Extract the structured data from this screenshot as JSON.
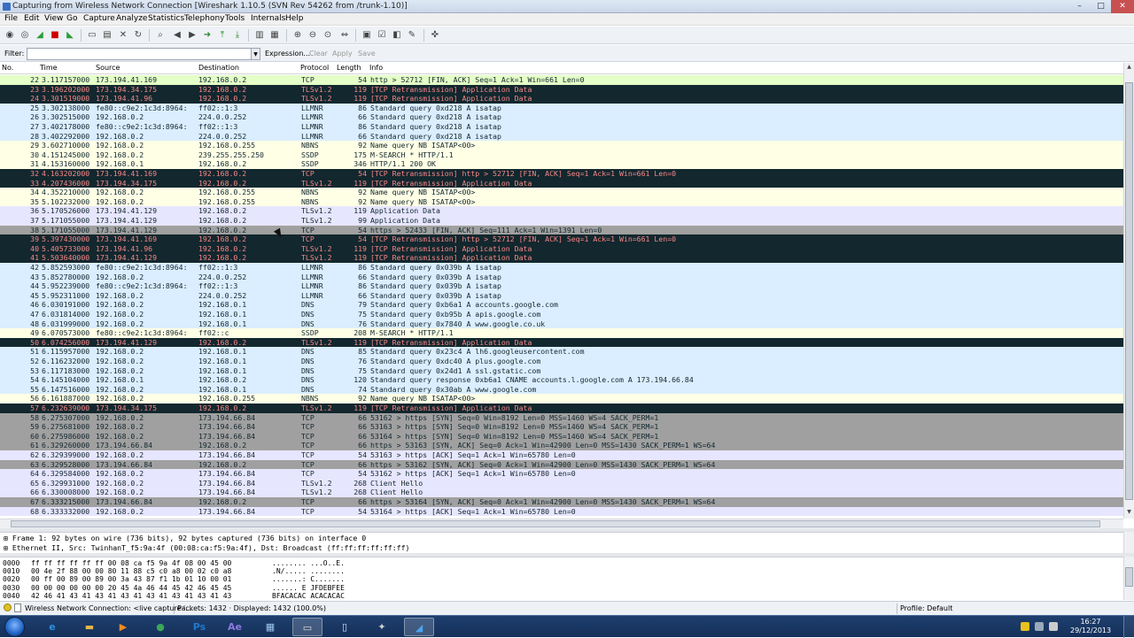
{
  "window": {
    "title": "Capturing from Wireless Network Connection   [Wireshark 1.10.5  (SVN Rev 54262 from /trunk-1.10)]",
    "min_icon": "minimize-icon",
    "max_icon": "maximize-icon",
    "close_icon": "close-icon",
    "min_glyph": "–",
    "max_glyph": "□",
    "close_glyph": "✕"
  },
  "menu": [
    "File",
    "Edit",
    "View",
    "Go",
    "Capture",
    "Analyze",
    "Statistics",
    "Telephony",
    "Tools",
    "Internals",
    "Help"
  ],
  "toolbar": {
    "icons": [
      {
        "name": "interfaces-icon",
        "glyph": "◉"
      },
      {
        "name": "options-icon",
        "glyph": "◎"
      },
      {
        "name": "start-capture-icon",
        "glyph": "◢"
      },
      {
        "name": "stop-capture-icon",
        "glyph": "■"
      },
      {
        "name": "restart-capture-icon",
        "glyph": "◣"
      },
      {
        "name": "open-file-icon",
        "glyph": "▭"
      },
      {
        "name": "save-file-icon",
        "glyph": "▤"
      },
      {
        "name": "close-file-icon",
        "glyph": "✕"
      },
      {
        "name": "reload-icon",
        "glyph": "↻"
      },
      {
        "name": "find-packet-icon",
        "glyph": "⌕"
      },
      {
        "name": "go-back-icon",
        "glyph": "◀"
      },
      {
        "name": "go-forward-icon",
        "glyph": "▶"
      },
      {
        "name": "go-to-packet-icon",
        "glyph": "➜"
      },
      {
        "name": "first-packet-icon",
        "glyph": "⤒"
      },
      {
        "name": "last-packet-icon",
        "glyph": "⤓"
      },
      {
        "name": "colorize-icon",
        "glyph": "▥"
      },
      {
        "name": "autoscroll-icon",
        "glyph": "▦"
      },
      {
        "name": "zoom-in-icon",
        "glyph": "⊕"
      },
      {
        "name": "zoom-out-icon",
        "glyph": "⊖"
      },
      {
        "name": "normal-size-icon",
        "glyph": "⊙"
      },
      {
        "name": "resize-columns-icon",
        "glyph": "⇔"
      },
      {
        "name": "capture-filters-icon",
        "glyph": "▣"
      },
      {
        "name": "display-filters-icon",
        "glyph": "☑"
      },
      {
        "name": "coloring-rules-icon",
        "glyph": "◧"
      },
      {
        "name": "preferences-icon",
        "glyph": "✎"
      },
      {
        "name": "help-icon",
        "glyph": "✜"
      }
    ]
  },
  "filter": {
    "label": "Filter:",
    "value": "",
    "dropdown_icon": "dropdown-arrow-icon",
    "dropdown_glyph": "▼",
    "expression": "Expression...",
    "clear": "Clear",
    "apply": "Apply",
    "save": "Save"
  },
  "columns": {
    "no": "No.",
    "time": "Time",
    "source": "Source",
    "destination": "Destination",
    "protocol": "Protocol",
    "length": "Length",
    "info": "Info"
  },
  "packets": [
    {
      "no": "22",
      "time": "3.117157000",
      "src": "173.194.41.169",
      "dst": "192.168.0.2",
      "proto": "TCP",
      "len": "54",
      "info": "http > 52712 [FIN, ACK] Seq=1 Ack=1 Win=661 Len=0",
      "kind": "http"
    },
    {
      "no": "23",
      "time": "3.196202000",
      "src": "173.194.34.175",
      "dst": "192.168.0.2",
      "proto": "TLSv1.2",
      "len": "119",
      "info": "[TCP Retransmission] Application Data",
      "kind": "tlsr"
    },
    {
      "no": "24",
      "time": "3.301519000",
      "src": "173.194.41.96",
      "dst": "192.168.0.2",
      "proto": "TLSv1.2",
      "len": "119",
      "info": "[TCP Retransmission] Application Data",
      "kind": "tlsr"
    },
    {
      "no": "25",
      "time": "3.302138000",
      "src": "fe80::c9e2:1c3d:8964:",
      "dst": "ff02::1:3",
      "proto": "LLMNR",
      "len": "86",
      "info": "Standard query 0xd218  A isatap",
      "kind": "llmnr"
    },
    {
      "no": "26",
      "time": "3.302515000",
      "src": "192.168.0.2",
      "dst": "224.0.0.252",
      "proto": "LLMNR",
      "len": "66",
      "info": "Standard query 0xd218  A isatap",
      "kind": "llmnr"
    },
    {
      "no": "27",
      "time": "3.402178000",
      "src": "fe80::c9e2:1c3d:8964:",
      "dst": "ff02::1:3",
      "proto": "LLMNR",
      "len": "86",
      "info": "Standard query 0xd218  A isatap",
      "kind": "llmnr"
    },
    {
      "no": "28",
      "time": "3.402292000",
      "src": "192.168.0.2",
      "dst": "224.0.0.252",
      "proto": "LLMNR",
      "len": "66",
      "info": "Standard query 0xd218  A isatap",
      "kind": "llmnr"
    },
    {
      "no": "29",
      "time": "3.602710000",
      "src": "192.168.0.2",
      "dst": "192.168.0.255",
      "proto": "NBNS",
      "len": "92",
      "info": "Name query NB ISATAP<00>",
      "kind": "nbns"
    },
    {
      "no": "30",
      "time": "4.151245000",
      "src": "192.168.0.2",
      "dst": "239.255.255.250",
      "proto": "SSDP",
      "len": "175",
      "info": "M-SEARCH * HTTP/1.1",
      "kind": "ssdp"
    },
    {
      "no": "31",
      "time": "4.153160000",
      "src": "192.168.0.1",
      "dst": "192.168.0.2",
      "proto": "SSDP",
      "len": "346",
      "info": "HTTP/1.1 200 OK",
      "kind": "ssdp"
    },
    {
      "no": "32",
      "time": "4.163202000",
      "src": "173.194.41.169",
      "dst": "192.168.0.2",
      "proto": "TCP",
      "len": "54",
      "info": "[TCP Retransmission] http > 52712 [FIN, ACK] Seq=1 Ack=1 Win=661 Len=0",
      "kind": "tlsr"
    },
    {
      "no": "33",
      "time": "4.207436000",
      "src": "173.194.34.175",
      "dst": "192.168.0.2",
      "proto": "TLSv1.2",
      "len": "119",
      "info": "[TCP Retransmission] Application Data",
      "kind": "tlsr"
    },
    {
      "no": "34",
      "time": "4.352210000",
      "src": "192.168.0.2",
      "dst": "192.168.0.255",
      "proto": "NBNS",
      "len": "92",
      "info": "Name query NB ISATAP<00>",
      "kind": "nbns"
    },
    {
      "no": "35",
      "time": "5.102232000",
      "src": "192.168.0.2",
      "dst": "192.168.0.255",
      "proto": "NBNS",
      "len": "92",
      "info": "Name query NB ISATAP<00>",
      "kind": "nbns"
    },
    {
      "no": "36",
      "time": "5.170526000",
      "src": "173.194.41.129",
      "dst": "192.168.0.2",
      "proto": "TLSv1.2",
      "len": "119",
      "info": "Application Data",
      "kind": "tls"
    },
    {
      "no": "37",
      "time": "5.171055000",
      "src": "173.194.41.129",
      "dst": "192.168.0.2",
      "proto": "TLSv1.2",
      "len": "99",
      "info": "Application Data",
      "kind": "tls"
    },
    {
      "no": "38",
      "time": "5.171055000",
      "src": "173.194.41.129",
      "dst": "192.168.0.2",
      "proto": "TCP",
      "len": "54",
      "info": "https > 52433 [FIN, ACK] Seq=111 Ack=1 Win=1391 Len=0",
      "kind": "fin"
    },
    {
      "no": "39",
      "time": "5.397430000",
      "src": "173.194.41.169",
      "dst": "192.168.0.2",
      "proto": "TCP",
      "len": "54",
      "info": "[TCP Retransmission] http > 52712 [FIN, ACK] Seq=1 Ack=1 Win=661 Len=0",
      "kind": "tlsr"
    },
    {
      "no": "40",
      "time": "5.405733000",
      "src": "173.194.41.96",
      "dst": "192.168.0.2",
      "proto": "TLSv1.2",
      "len": "119",
      "info": "[TCP Retransmission] Application Data",
      "kind": "tlsr"
    },
    {
      "no": "41",
      "time": "5.503640000",
      "src": "173.194.41.129",
      "dst": "192.168.0.2",
      "proto": "TLSv1.2",
      "len": "119",
      "info": "[TCP Retransmission] Application Data",
      "kind": "tlsr"
    },
    {
      "no": "42",
      "time": "5.852593000",
      "src": "fe80::c9e2:1c3d:8964:",
      "dst": "ff02::1:3",
      "proto": "LLMNR",
      "len": "86",
      "info": "Standard query 0x039b  A isatap",
      "kind": "llmnr"
    },
    {
      "no": "43",
      "time": "5.852780000",
      "src": "192.168.0.2",
      "dst": "224.0.0.252",
      "proto": "LLMNR",
      "len": "66",
      "info": "Standard query 0x039b  A isatap",
      "kind": "llmnr"
    },
    {
      "no": "44",
      "time": "5.952239000",
      "src": "fe80::c9e2:1c3d:8964:",
      "dst": "ff02::1:3",
      "proto": "LLMNR",
      "len": "86",
      "info": "Standard query 0x039b  A isatap",
      "kind": "llmnr"
    },
    {
      "no": "45",
      "time": "5.952311000",
      "src": "192.168.0.2",
      "dst": "224.0.0.252",
      "proto": "LLMNR",
      "len": "66",
      "info": "Standard query 0x039b  A isatap",
      "kind": "llmnr"
    },
    {
      "no": "46",
      "time": "6.030191000",
      "src": "192.168.0.2",
      "dst": "192.168.0.1",
      "proto": "DNS",
      "len": "79",
      "info": "Standard query 0xb6a1  A accounts.google.com",
      "kind": "dns"
    },
    {
      "no": "47",
      "time": "6.031814000",
      "src": "192.168.0.2",
      "dst": "192.168.0.1",
      "proto": "DNS",
      "len": "75",
      "info": "Standard query 0xb95b  A apis.google.com",
      "kind": "dns"
    },
    {
      "no": "48",
      "time": "6.031999000",
      "src": "192.168.0.2",
      "dst": "192.168.0.1",
      "proto": "DNS",
      "len": "76",
      "info": "Standard query 0x7840  A www.google.co.uk",
      "kind": "dns"
    },
    {
      "no": "49",
      "time": "6.070573000",
      "src": "fe80::c9e2:1c3d:8964:",
      "dst": "ff02::c",
      "proto": "SSDP",
      "len": "208",
      "info": "M-SEARCH * HTTP/1.1",
      "kind": "ssdp"
    },
    {
      "no": "50",
      "time": "6.074256000",
      "src": "173.194.41.129",
      "dst": "192.168.0.2",
      "proto": "TLSv1.2",
      "len": "119",
      "info": "[TCP Retransmission] Application Data",
      "kind": "tlsr"
    },
    {
      "no": "51",
      "time": "6.115957000",
      "src": "192.168.0.2",
      "dst": "192.168.0.1",
      "proto": "DNS",
      "len": "85",
      "info": "Standard query 0x23c4  A lh6.googleusercontent.com",
      "kind": "dns"
    },
    {
      "no": "52",
      "time": "6.116232000",
      "src": "192.168.0.2",
      "dst": "192.168.0.1",
      "proto": "DNS",
      "len": "76",
      "info": "Standard query 0xdc40  A plus.google.com",
      "kind": "dns"
    },
    {
      "no": "53",
      "time": "6.117183000",
      "src": "192.168.0.2",
      "dst": "192.168.0.1",
      "proto": "DNS",
      "len": "75",
      "info": "Standard query 0x24d1  A ssl.gstatic.com",
      "kind": "dns"
    },
    {
      "no": "54",
      "time": "6.145104000",
      "src": "192.168.0.1",
      "dst": "192.168.0.2",
      "proto": "DNS",
      "len": "120",
      "info": "Standard query response 0xb6a1  CNAME accounts.l.google.com A 173.194.66.84",
      "kind": "dns"
    },
    {
      "no": "55",
      "time": "6.147516000",
      "src": "192.168.0.2",
      "dst": "192.168.0.1",
      "proto": "DNS",
      "len": "74",
      "info": "Standard query 0x30ab  A www.google.com",
      "kind": "dns"
    },
    {
      "no": "56",
      "time": "6.161887000",
      "src": "192.168.0.2",
      "dst": "192.168.0.255",
      "proto": "NBNS",
      "len": "92",
      "info": "Name query NB ISATAP<00>",
      "kind": "nbns"
    },
    {
      "no": "57",
      "time": "6.232639000",
      "src": "173.194.34.175",
      "dst": "192.168.0.2",
      "proto": "TLSv1.2",
      "len": "119",
      "info": "[TCP Retransmission] Application Data",
      "kind": "tlsr"
    },
    {
      "no": "58",
      "time": "6.275307000",
      "src": "192.168.0.2",
      "dst": "173.194.66.84",
      "proto": "TCP",
      "len": "66",
      "info": "53162 > https [SYN] Seq=0 Win=8192 Len=0 MSS=1460 WS=4 SACK_PERM=1",
      "kind": "syn"
    },
    {
      "no": "59",
      "time": "6.275681000",
      "src": "192.168.0.2",
      "dst": "173.194.66.84",
      "proto": "TCP",
      "len": "66",
      "info": "53163 > https [SYN] Seq=0 Win=8192 Len=0 MSS=1460 WS=4 SACK_PERM=1",
      "kind": "syn"
    },
    {
      "no": "60",
      "time": "6.275986000",
      "src": "192.168.0.2",
      "dst": "173.194.66.84",
      "proto": "TCP",
      "len": "66",
      "info": "53164 > https [SYN] Seq=0 Win=8192 Len=0 MSS=1460 WS=4 SACK_PERM=1",
      "kind": "syn"
    },
    {
      "no": "61",
      "time": "6.329260000",
      "src": "173.194.66.84",
      "dst": "192.168.0.2",
      "proto": "TCP",
      "len": "66",
      "info": "https > 53163 [SYN, ACK] Seq=0 Ack=1 Win=42900 Len=0 MSS=1430 SACK_PERM=1 WS=64",
      "kind": "syn"
    },
    {
      "no": "62",
      "time": "6.329399000",
      "src": "192.168.0.2",
      "dst": "173.194.66.84",
      "proto": "TCP",
      "len": "54",
      "info": "53163 > https [ACK] Seq=1 Ack=1 Win=65780 Len=0",
      "kind": "tcp"
    },
    {
      "no": "63",
      "time": "6.329528000",
      "src": "173.194.66.84",
      "dst": "192.168.0.2",
      "proto": "TCP",
      "len": "66",
      "info": "https > 53162 [SYN, ACK] Seq=0 Ack=1 Win=42900 Len=0 MSS=1430 SACK_PERM=1 WS=64",
      "kind": "syn"
    },
    {
      "no": "64",
      "time": "6.329584000",
      "src": "192.168.0.2",
      "dst": "173.194.66.84",
      "proto": "TCP",
      "len": "54",
      "info": "53162 > https [ACK] Seq=1 Ack=1 Win=65780 Len=0",
      "kind": "tcp"
    },
    {
      "no": "65",
      "time": "6.329931000",
      "src": "192.168.0.2",
      "dst": "173.194.66.84",
      "proto": "TLSv1.2",
      "len": "268",
      "info": "Client Hello",
      "kind": "tcp"
    },
    {
      "no": "66",
      "time": "6.330008000",
      "src": "192.168.0.2",
      "dst": "173.194.66.84",
      "proto": "TLSv1.2",
      "len": "268",
      "info": "Client Hello",
      "kind": "tcp"
    },
    {
      "no": "67",
      "time": "6.333215000",
      "src": "173.194.66.84",
      "dst": "192.168.0.2",
      "proto": "TCP",
      "len": "66",
      "info": "https > 53164 [SYN, ACK] Seq=0 Ack=1 Win=42900 Len=0 MSS=1430 SACK_PERM=1 WS=64",
      "kind": "syn"
    },
    {
      "no": "68",
      "time": "6.333332000",
      "src": "192.168.0.2",
      "dst": "173.194.66.84",
      "proto": "TCP",
      "len": "54",
      "info": "53164 > https [ACK] Seq=1 Ack=1 Win=65780 Len=0",
      "kind": "tcp"
    }
  ],
  "details": [
    {
      "expander": "⊞",
      "text": "Frame 1: 92 bytes on wire (736 bits), 92 bytes captured (736 bits) on interface 0"
    },
    {
      "expander": "⊞",
      "text": "Ethernet II, Src: TwinhanT_f5:9a:4f (00:08:ca:f5:9a:4f), Dst: Broadcast (ff:ff:ff:ff:ff:ff)"
    }
  ],
  "bytes": [
    {
      "offset": "0000",
      "hex": "ff ff ff ff ff ff 00 08  ca f5 9a 4f 08 00 45 00",
      "ascii": "........ ...O..E."
    },
    {
      "offset": "0010",
      "hex": "00 4e 2f 88 00 00 80 11  88 c5 c0 a8 00 02 c0 a8",
      "ascii": ".N/..... ........"
    },
    {
      "offset": "0020",
      "hex": "00 ff 00 89 00 89 00 3a  43 87 f1 1b 01 10 00 01",
      "ascii": ".......: C......."
    },
    {
      "offset": "0030",
      "hex": "00 00 00 00 00 00 20 45  4a 46 44 45 42 46 45 45",
      "ascii": "...... E JFDEBFEE"
    },
    {
      "offset": "0040",
      "hex": "42 46 41 43 41 43 41 43  41 43 41 43 41 43 41 43",
      "ascii": "BFACACAC ACACACAC"
    },
    {
      "offset": "0050",
      "hex": "41 43 41 43 41 41 00 00  20 00 01",
      "ascii": "ACACAA.. ..."
    }
  ],
  "status": {
    "interface": "Wireless Network Connection: <live capture i...",
    "packets": "Packets: 1432 · Displayed: 1432 (100.0%)",
    "profile": "Profile: Default"
  },
  "taskbar": {
    "start_icon": "windows-start-icon",
    "apps": [
      {
        "name": "internet-explorer-icon",
        "glyph": "e",
        "color": "#2f8fe0"
      },
      {
        "name": "windows-explorer-icon",
        "glyph": "▬",
        "color": "#e3b74a"
      },
      {
        "name": "media-player-icon",
        "glyph": "▶",
        "color": "#f08a20"
      },
      {
        "name": "chrome-icon",
        "glyph": "●",
        "color": "#3aa757"
      },
      {
        "name": "photoshop-icon",
        "glyph": "Ps",
        "color": "#1f7acb"
      },
      {
        "name": "after-effects-icon",
        "glyph": "Ae",
        "color": "#8d7ae0"
      },
      {
        "name": "network-app-icon",
        "glyph": "▦",
        "color": "#9cc6ef"
      },
      {
        "name": "command-prompt-icon",
        "glyph": "▭",
        "color": "#dddddd"
      },
      {
        "name": "notepad-icon",
        "glyph": "▯",
        "color": "#cfe2f6"
      },
      {
        "name": "network-tool-icon",
        "glyph": "✦",
        "color": "#d0d0d0"
      },
      {
        "name": "wireshark-icon",
        "glyph": "◢",
        "color": "#4aa3f0"
      }
    ],
    "time": "16:27",
    "date": "29/12/2013"
  }
}
